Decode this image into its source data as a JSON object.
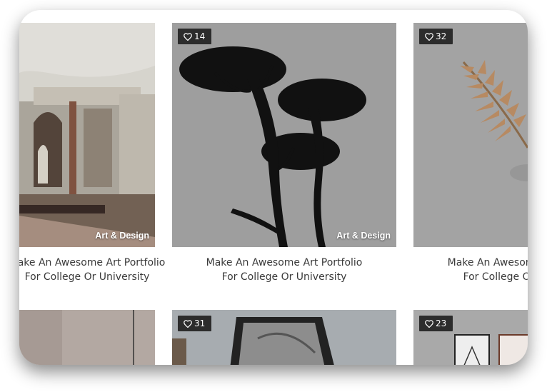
{
  "cards": [
    {
      "likes": "14",
      "category": "Art & Design",
      "title_line1": "Make An Awesome Art Portfolio",
      "title_line2": "For College Or University"
    },
    {
      "likes": "32",
      "category": "",
      "title_line1": "Make An Awesome Art Portfolio",
      "title_line2": "For College Or University"
    },
    {
      "likes": "",
      "category": "Art & Design",
      "title_line1": "Make An Awesome Art Portfolio",
      "title_line2": "For College Or University"
    },
    {
      "likes": "31"
    },
    {
      "likes": "23"
    }
  ],
  "colors": {
    "badge_bg": "#2c2c2c",
    "title_text": "#3a3a3a",
    "card_overlay": "#9c9c9c"
  }
}
